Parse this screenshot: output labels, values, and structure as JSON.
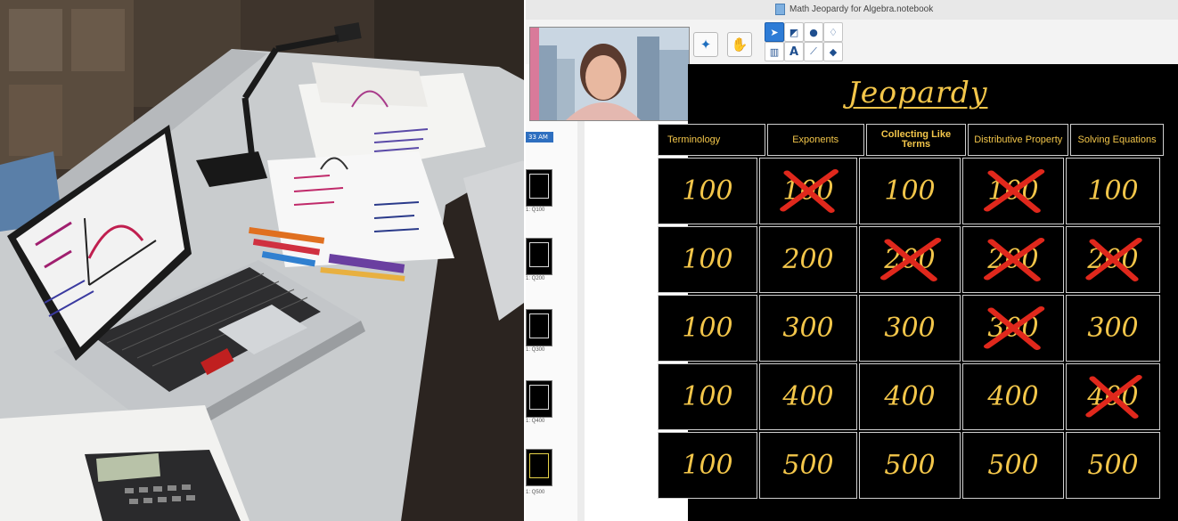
{
  "window": {
    "title": "Math Jeopardy for Algebra.notebook"
  },
  "sidebar": {
    "time_label": "33 AM",
    "pages": [
      {
        "label": "1: Q100"
      },
      {
        "label": "1: Q200"
      },
      {
        "label": "1: Q300"
      },
      {
        "label": "1: Q400"
      },
      {
        "label": "1: Q500"
      }
    ]
  },
  "slide": {
    "title": "Jeopardy",
    "categories": [
      {
        "label": "Terminology"
      },
      {
        "label": "Exponents"
      },
      {
        "label": "Collecting Like Terms"
      },
      {
        "label": "Distributive Property"
      },
      {
        "label": "Solving Equations"
      }
    ],
    "rows": [
      [
        {
          "value": "100",
          "crossed": false
        },
        {
          "value": "100",
          "crossed": true
        },
        {
          "value": "100",
          "crossed": false
        },
        {
          "value": "100",
          "crossed": true
        },
        {
          "value": "100",
          "crossed": false
        }
      ],
      [
        {
          "value": "100",
          "crossed": false
        },
        {
          "value": "200",
          "crossed": false
        },
        {
          "value": "200",
          "crossed": true
        },
        {
          "value": "200",
          "crossed": true
        },
        {
          "value": "200",
          "crossed": true
        }
      ],
      [
        {
          "value": "100",
          "crossed": false
        },
        {
          "value": "300",
          "crossed": false
        },
        {
          "value": "300",
          "crossed": false
        },
        {
          "value": "300",
          "crossed": true
        },
        {
          "value": "300",
          "crossed": false
        }
      ],
      [
        {
          "value": "100",
          "crossed": false
        },
        {
          "value": "400",
          "crossed": false
        },
        {
          "value": "400",
          "crossed": false
        },
        {
          "value": "400",
          "crossed": false
        },
        {
          "value": "400",
          "crossed": true
        }
      ],
      [
        {
          "value": "100",
          "crossed": false
        },
        {
          "value": "500",
          "crossed": false
        },
        {
          "value": "500",
          "crossed": false
        },
        {
          "value": "500",
          "crossed": false
        },
        {
          "value": "500",
          "crossed": false
        }
      ]
    ]
  },
  "colors": {
    "gold": "#f3c64a",
    "cross": "#e0281c",
    "grid": "#cfcfcf"
  }
}
